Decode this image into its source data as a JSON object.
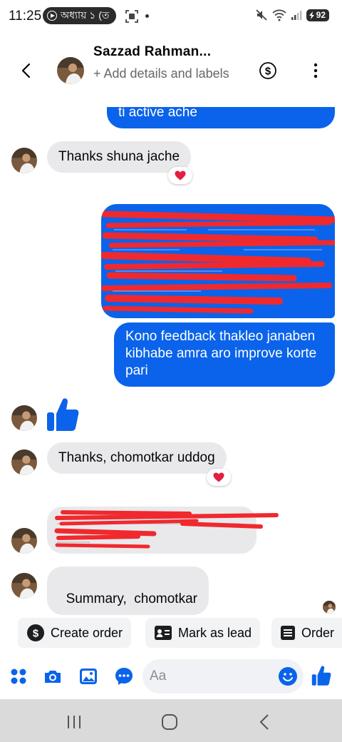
{
  "status_bar": {
    "time": "11:25",
    "notification_text": "অধ্যায় ১ (ত",
    "battery": "92",
    "icons": [
      "play-circle-icon",
      "scan-icon",
      "mute-icon",
      "wifi-icon",
      "signal-icon",
      "battery-icon"
    ]
  },
  "header": {
    "contact_name": "Sazzad Rahman...",
    "sub_label": "+ Add details and labels",
    "back_icon": "chevron-left-icon",
    "dollar_icon": "dollar-circle-icon",
    "more_icon": "more-vertical-icon"
  },
  "messages": [
    {
      "id": "m0",
      "direction": "out",
      "text": "ti active ache"
    },
    {
      "id": "m1",
      "direction": "in",
      "text": "Thanks shuna jache",
      "reaction": "heart"
    },
    {
      "id": "m2",
      "direction": "out",
      "text": "",
      "redacted": true
    },
    {
      "id": "m3",
      "direction": "out",
      "text": "Kono feedback thakleo janaben kibhabe amra aro improve korte pari"
    },
    {
      "id": "m4",
      "direction": "in",
      "type": "like-sticker"
    },
    {
      "id": "m5",
      "direction": "in",
      "text": "Thanks, chomotkar uddog",
      "reaction": "heart"
    },
    {
      "id": "m6",
      "direction": "in",
      "text": "",
      "redacted": true
    },
    {
      "id": "m7",
      "direction": "in",
      "text": "Summary,  chomotkar"
    }
  ],
  "quick_actions": [
    {
      "label": "Create order",
      "icon": "dollar-circle-icon"
    },
    {
      "label": "Mark as lead",
      "icon": "contact-card-icon"
    },
    {
      "label": "Order",
      "icon": "list-icon"
    }
  ],
  "composer": {
    "placeholder": "Aa",
    "icons": [
      "apps-grid-icon",
      "camera-icon",
      "gallery-icon",
      "chat-bubble-icon",
      "emoji-icon",
      "like-icon"
    ]
  },
  "colors": {
    "accent": "#0a63ea",
    "incoming_bubble": "#e9e9eb",
    "heart": "#e41e3f",
    "redaction": "#f0292e"
  }
}
